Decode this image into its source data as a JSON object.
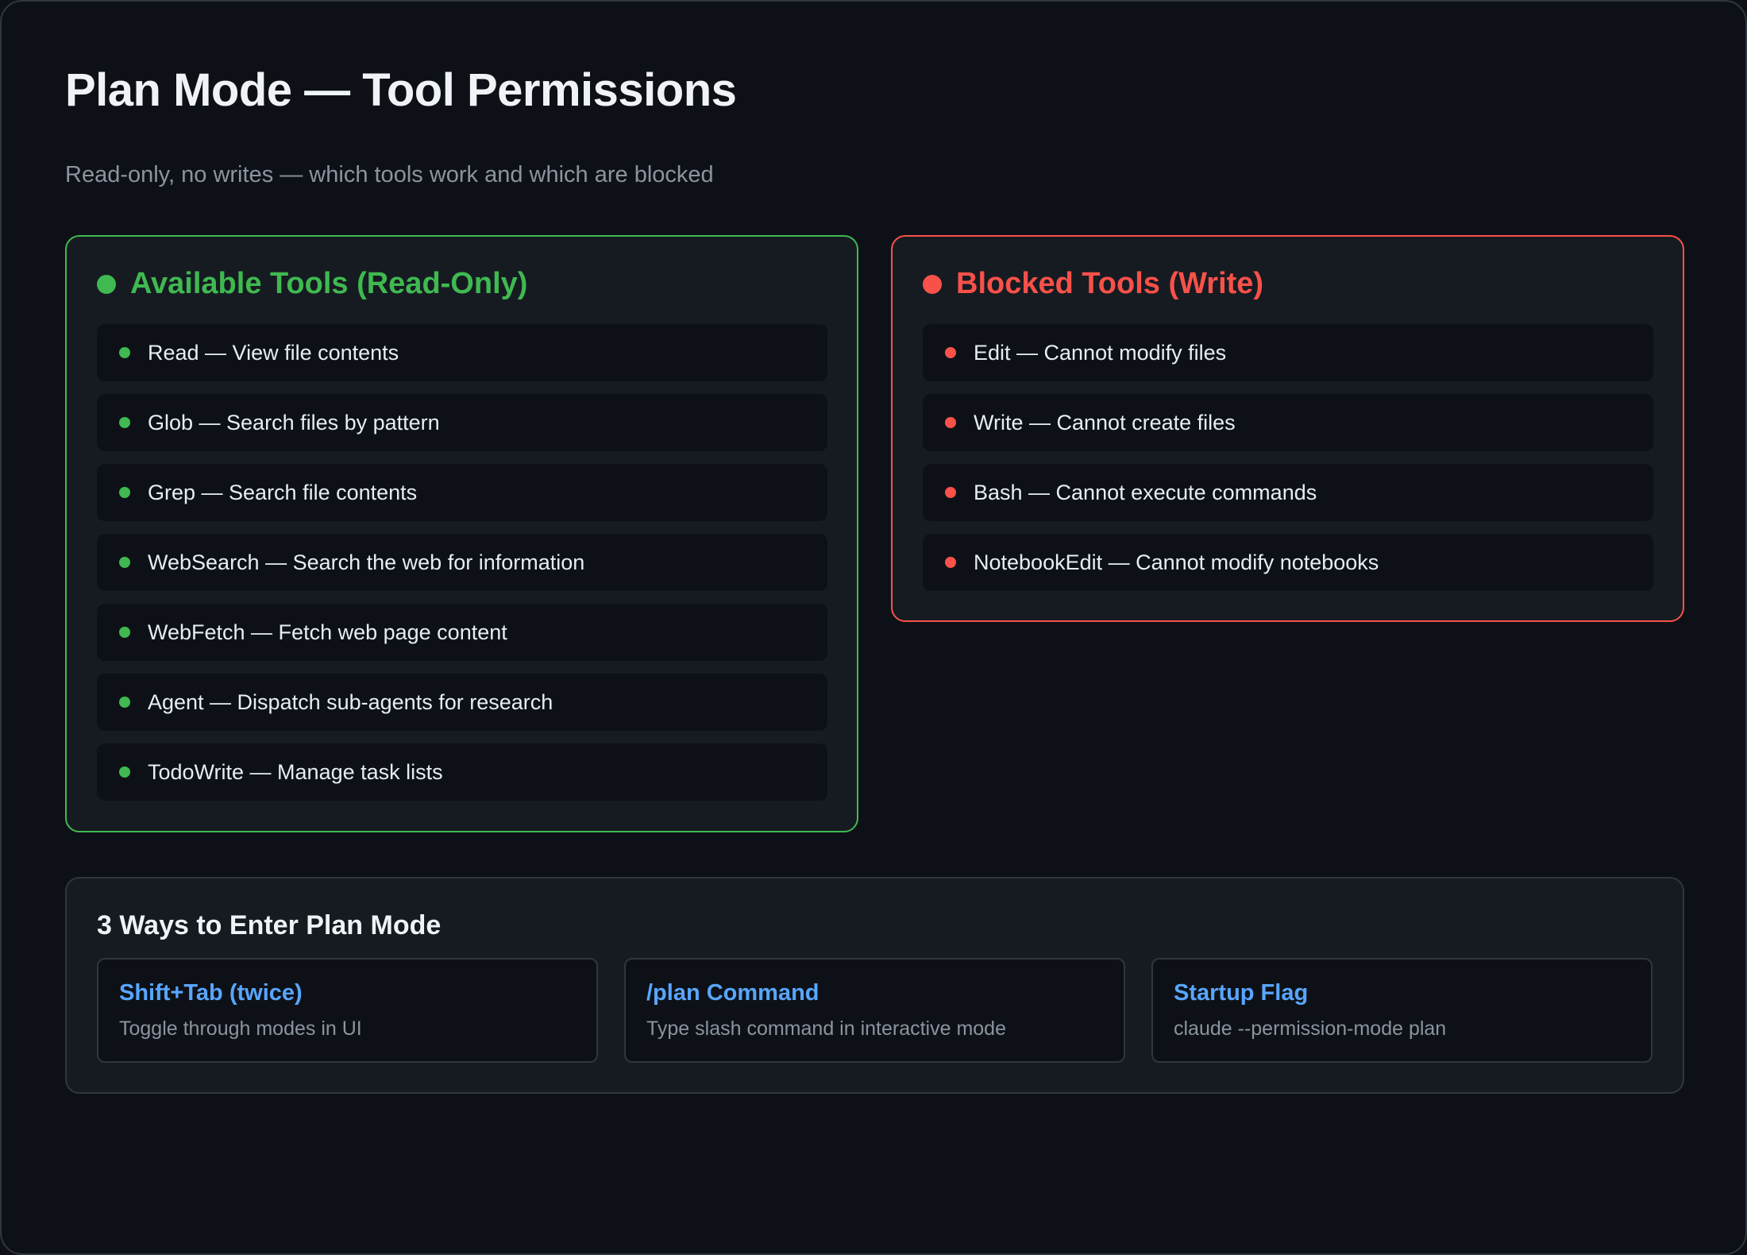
{
  "header": {
    "title": "Plan Mode — Tool Permissions",
    "subtitle": "Read-only, no writes — which tools work and which are blocked"
  },
  "available": {
    "title": "Available Tools (Read-Only)",
    "color": "#3fb950",
    "tools": [
      "Read — View file contents",
      "Glob — Search files by pattern",
      "Grep — Search file contents",
      "WebSearch — Search the web for information",
      "WebFetch — Fetch web page content",
      "Agent — Dispatch sub-agents for research",
      "TodoWrite — Manage task lists"
    ]
  },
  "blocked": {
    "title": "Blocked Tools (Write)",
    "color": "#f85149",
    "tools": [
      "Edit — Cannot modify files",
      "Write — Cannot create files",
      "Bash — Cannot execute commands",
      "NotebookEdit — Cannot modify notebooks"
    ]
  },
  "ways": {
    "title": "3 Ways to Enter Plan Mode",
    "accent": "#58a6ff",
    "items": [
      {
        "title": "Shift+Tab (twice)",
        "desc": "Toggle through modes in UI"
      },
      {
        "title": "/plan Command",
        "desc": "Type slash command in interactive mode"
      },
      {
        "title": "Startup Flag",
        "desc": "claude --permission-mode plan"
      }
    ]
  }
}
